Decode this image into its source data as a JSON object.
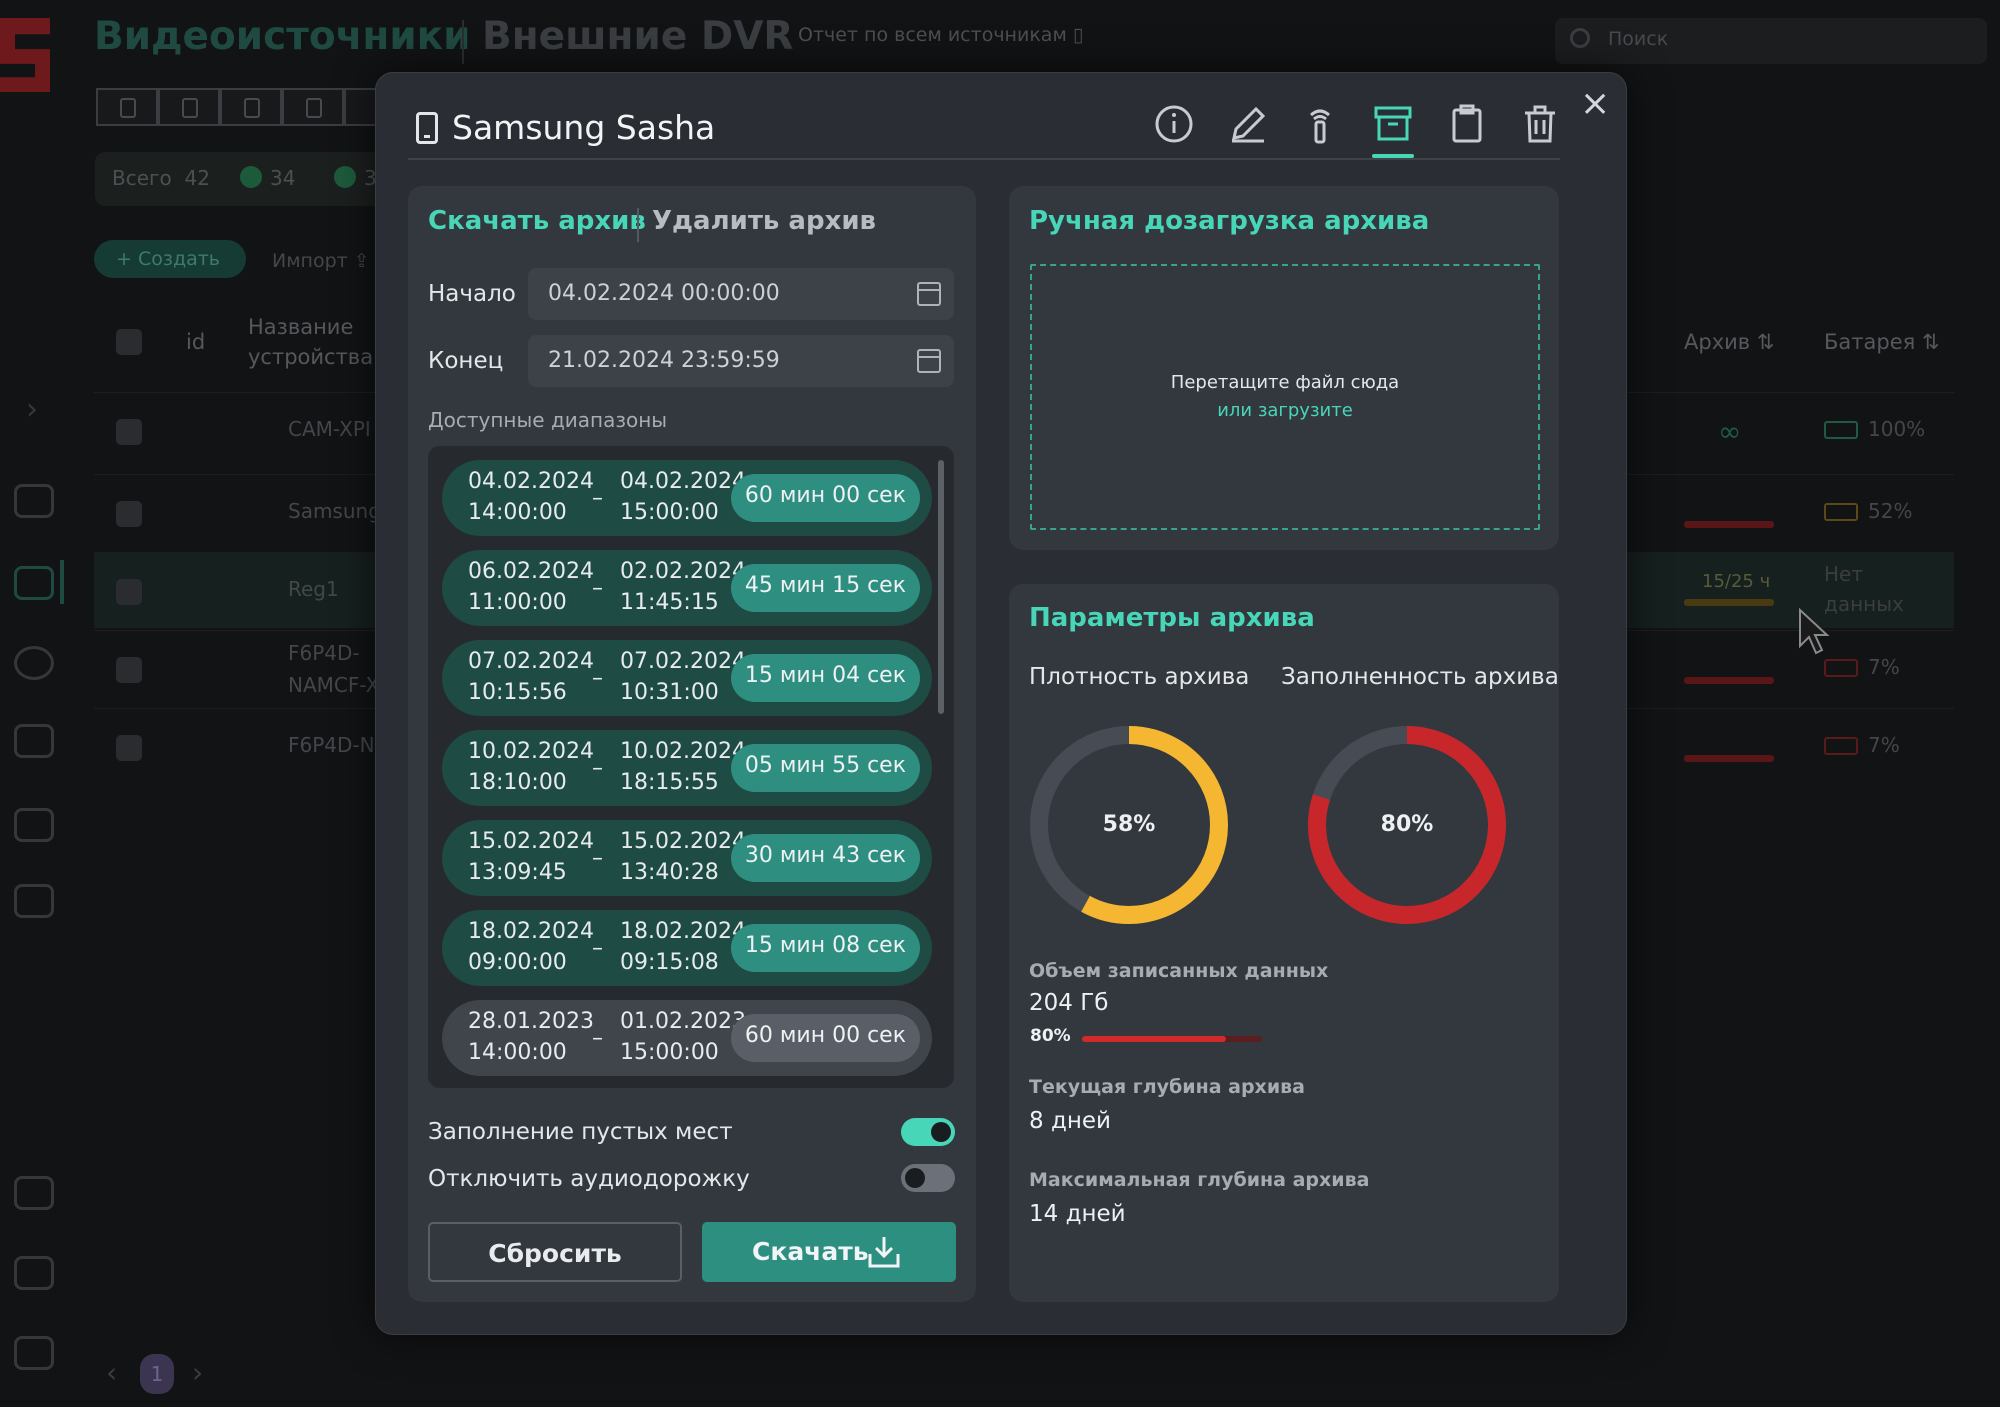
{
  "background": {
    "title": "Видеоисточники",
    "title2": "Внешние DVR",
    "report_link": "Отчет по всем источникам",
    "search_placeholder": "Поиск",
    "total_label": "Всего",
    "total_count": "42",
    "online_count": "34",
    "online2_count": "3",
    "create_button": "Создать",
    "import_button": "Импорт",
    "columns": {
      "id": "id",
      "name": "Название устройства",
      "archive": "Архив",
      "battery": "Батарея"
    },
    "rows": [
      {
        "name": "CAM-XPI",
        "archive": "∞",
        "battery": "100%"
      },
      {
        "name": "Samsung",
        "archive": "",
        "battery": "52%"
      },
      {
        "name": "Reg1",
        "archive": "15/25 ч",
        "battery": "Нет данных"
      },
      {
        "name": "F6P4D-NAMCF-X",
        "archive": "",
        "battery": "7%"
      },
      {
        "name": "F6P4D-N",
        "archive": "",
        "battery": "7%"
      }
    ],
    "page": "1"
  },
  "modal": {
    "title": "Samsung Sasha",
    "close_icon": "close-icon",
    "toolbar_icons": [
      "info-icon",
      "edit-icon",
      "signal-icon",
      "archive-icon",
      "clipboard-icon",
      "trash-icon"
    ],
    "active_tab_index": 3
  },
  "download": {
    "tab_download": "Скачать архив",
    "tab_delete": "Удалить архив",
    "start_label": "Начало",
    "start_value": "04.02.2024  00:00:00",
    "end_label": "Конец",
    "end_value": "21.02.2024  23:59:59",
    "ranges_label": "Доступные диапазоны",
    "ranges": [
      {
        "from_date": "04.02.2024",
        "from_time": "14:00:00",
        "to_date": "04.02.2024",
        "to_time": "15:00:00",
        "duration": "60 мин 00 сек",
        "selected": true
      },
      {
        "from_date": "06.02.2024",
        "from_time": "11:00:00",
        "to_date": "02.02.2024",
        "to_time": "11:45:15",
        "duration": "45 мин 15 сек",
        "selected": true
      },
      {
        "from_date": "07.02.2024",
        "from_time": "10:15:56",
        "to_date": "07.02.2024",
        "to_time": "10:31:00",
        "duration": "15 мин 04 сек",
        "selected": true
      },
      {
        "from_date": "10.02.2024",
        "from_time": "18:10:00",
        "to_date": "10.02.2024",
        "to_time": "18:15:55",
        "duration": "05 мин 55 сек",
        "selected": true
      },
      {
        "from_date": "15.02.2024",
        "from_time": "13:09:45",
        "to_date": "15.02.2024",
        "to_time": "13:40:28",
        "duration": "30 мин 43 сек",
        "selected": true
      },
      {
        "from_date": "18.02.2024",
        "from_time": "09:00:00",
        "to_date": "18.02.2024",
        "to_time": "09:15:08",
        "duration": "15 мин 08 сек",
        "selected": true
      },
      {
        "from_date": "28.01.2023",
        "from_time": "14:00:00",
        "to_date": "01.02.2023",
        "to_time": "15:00:00",
        "duration": "60 мин 00 сек",
        "selected": false
      }
    ],
    "fill_gaps_label": "Заполнение пустых мест",
    "fill_gaps_on": true,
    "mute_audio_label": "Отключить аудиодорожку",
    "mute_audio_on": false,
    "reset_button": "Сбросить",
    "download_button": "Скачать"
  },
  "upload": {
    "title": "Ручная дозагрузка архива",
    "drop_text": "Перетащите файл сюда",
    "upload_link": "или загрузите"
  },
  "params": {
    "title": "Параметры архива",
    "density_label": "Плотность архива",
    "density_value": "58%",
    "density_fraction": 0.58,
    "density_color": "#f5b731",
    "fill_label": "Заполненность архива",
    "fill_value": "80%",
    "fill_fraction": 0.8,
    "fill_color": "#c7272b",
    "recorded_label": "Объем записанных данных",
    "recorded_value": "204 Гб",
    "recorded_percent": "80%",
    "recorded_fraction": 0.8,
    "depth_label": "Текущая глубина архива",
    "depth_value": "8 дней",
    "max_depth_label": "Максимальная глубина архива",
    "max_depth_value": "14 дней"
  },
  "colors": {
    "accent": "#48d6b9",
    "range_bg": "#1f4b45",
    "range_pill": "#2e8f80"
  }
}
